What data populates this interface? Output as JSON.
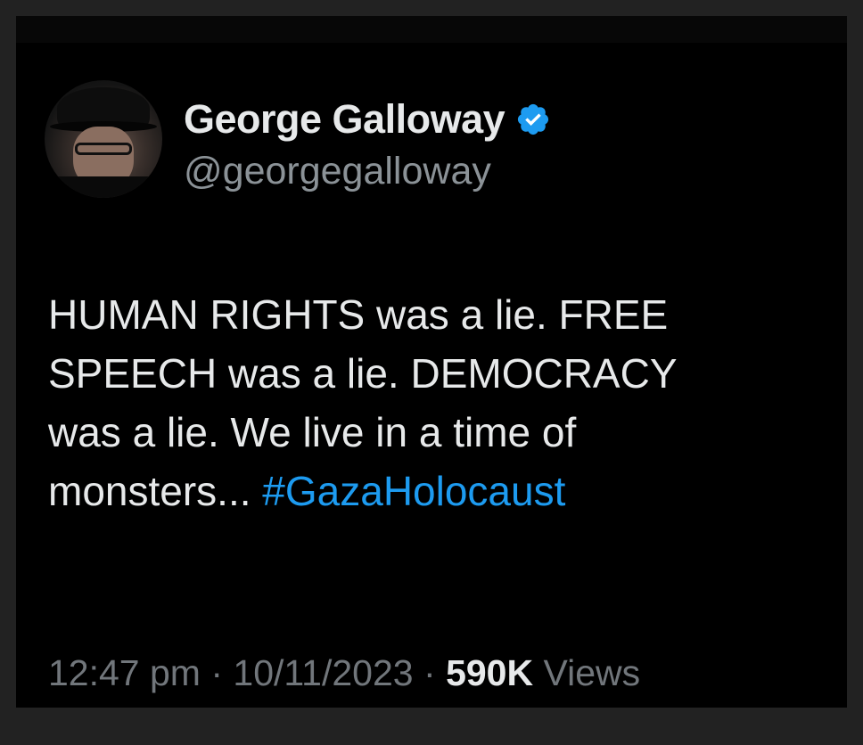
{
  "author": {
    "name": "George Galloway",
    "handle": "@georgegalloway",
    "verified": true
  },
  "tweet": {
    "lines": [
      "HUMAN RIGHTS was a lie. FREE",
      "SPEECH was a lie. DEMOCRACY",
      "was a lie. We live in a time of",
      "monsters... "
    ],
    "hashtag": "#GazaHolocaust"
  },
  "meta": {
    "time": "12:47 pm",
    "separator": "·",
    "date": "10/11/2023",
    "views_count": "590K",
    "views_label": "Views"
  },
  "colors": {
    "background": "#000000",
    "text": "#e7e9ea",
    "muted": "#71767b",
    "link": "#1d9bf0",
    "verified_badge": "#1d9bf0"
  },
  "icons": {
    "verified": "verified-badge-icon"
  }
}
